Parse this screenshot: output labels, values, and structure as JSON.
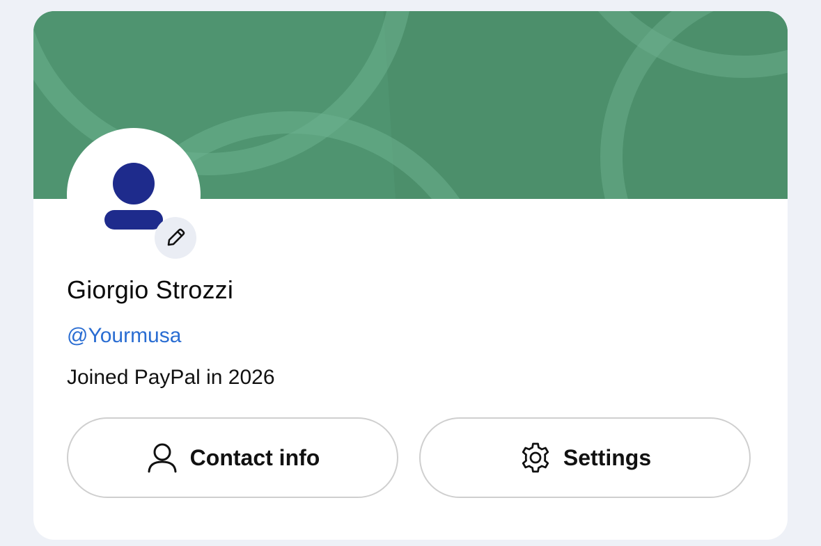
{
  "profile": {
    "name": "Giorgio Strozzi",
    "handle": "@Yourmusa",
    "joined": "Joined PayPal in 2026"
  },
  "icons": {
    "avatar": "person-silhouette-icon",
    "edit": "pencil-icon",
    "contact": "person-outline-icon",
    "settings": "gear-icon"
  },
  "buttons": {
    "contact_label": "Contact info",
    "settings_label": "Settings"
  },
  "colors": {
    "banner": "#4f9470",
    "avatar_fill": "#1e2b8c",
    "handle": "#2a6dd2",
    "page_bg": "#eef1f7"
  }
}
